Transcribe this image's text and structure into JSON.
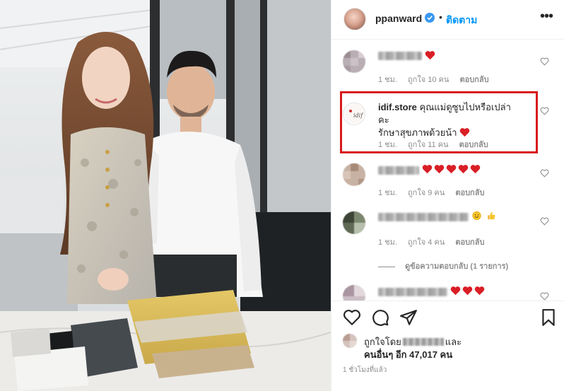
{
  "post": {
    "username": "ppanward",
    "separator": "•",
    "follow_label": "ติดตาม",
    "more_icon": "more-dots-icon"
  },
  "comments": [
    {
      "username": "",
      "text": "",
      "emojis": [
        "red-heart"
      ],
      "time": "1 ชม.",
      "likes": "ถูกใจ 10 คน",
      "reply": "ตอบกลับ"
    },
    {
      "username": "idif.store",
      "text_line1": "คุณแม่ดูซูบไปหรือเปล่าคะ",
      "text_line2": "รักษาสุขภาพด้วยน้า",
      "emojis": [
        "red-heart"
      ],
      "time": "1 ชม.",
      "likes": "ถูกใจ 11 คน",
      "reply": "ตอบกลับ"
    },
    {
      "username": "",
      "text": "",
      "emojis": [
        "red-heart",
        "red-heart",
        "red-heart",
        "red-heart",
        "red-heart"
      ],
      "time": "1 ชม.",
      "likes": "ถูกใจ 9 คน",
      "reply": "ตอบกลับ"
    },
    {
      "username": "",
      "text": "",
      "emojis": [
        "smile",
        "thumbs-up"
      ],
      "time": "1 ชม.",
      "likes": "ถูกใจ 4 คน",
      "reply": "ตอบกลับ",
      "view_replies": "ดูข้อความตอบกลับ (1 รายการ)"
    },
    {
      "username": "",
      "text": "",
      "emojis": [
        "red-heart",
        "red-heart",
        "red-heart"
      ]
    }
  ],
  "actions": {
    "like_icon": "heart-outline-icon",
    "comment_icon": "comment-icon",
    "share_icon": "paper-plane-icon",
    "save_icon": "bookmark-icon"
  },
  "likes": {
    "prefix": "ถูกใจโดย",
    "suffix": "และ",
    "others": "คนอื่นๆ อีก 47,017 คน"
  },
  "timestamp": "1 ชั่วโมงที่แล้ว",
  "colors": {
    "accent": "#0095f6",
    "heart": "#ed4956",
    "highlight": "#d8191b",
    "muted": "#8e8e8e"
  }
}
